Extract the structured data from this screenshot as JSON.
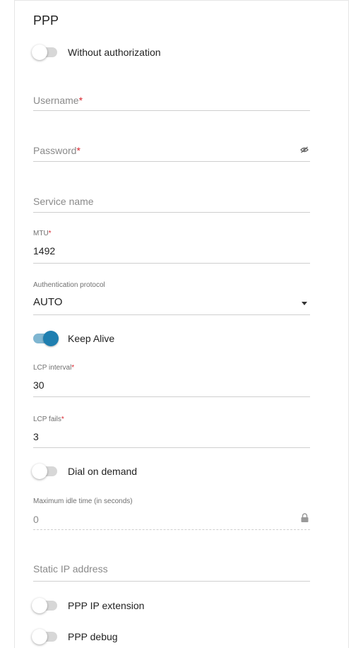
{
  "section": {
    "title": "PPP"
  },
  "toggles": {
    "without_auth": {
      "label": "Without authorization",
      "on": false
    },
    "keep_alive": {
      "label": "Keep Alive",
      "on": true
    },
    "dial_on_demand": {
      "label": "Dial on demand",
      "on": false
    },
    "ppp_ip_extension": {
      "label": "PPP IP extension",
      "on": false
    },
    "ppp_debug": {
      "label": "PPP debug",
      "on": false
    }
  },
  "fields": {
    "username": {
      "placeholder": "Username",
      "required": "*",
      "value": ""
    },
    "password": {
      "placeholder": "Password",
      "required": "*",
      "value": "",
      "icon": "eye-off-icon"
    },
    "service_name": {
      "placeholder": "Service name",
      "value": ""
    },
    "mtu": {
      "label": "MTU",
      "required": "*",
      "value": "1492"
    },
    "auth_protocol": {
      "label": "Authentication protocol",
      "value": "AUTO",
      "icon": "chevron-down-icon"
    },
    "lcp_interval": {
      "label": "LCP interval",
      "required": "*",
      "value": "30"
    },
    "lcp_fails": {
      "label": "LCP fails",
      "required": "*",
      "value": "3"
    },
    "max_idle_time": {
      "label": "Maximum idle time (in seconds)",
      "value": "0",
      "icon": "lock-icon"
    },
    "static_ip": {
      "placeholder": "Static IP address",
      "value": ""
    }
  },
  "colors": {
    "accent": "#1f7fb0",
    "required": "#d9262f",
    "divider": "#cfcfcf"
  }
}
